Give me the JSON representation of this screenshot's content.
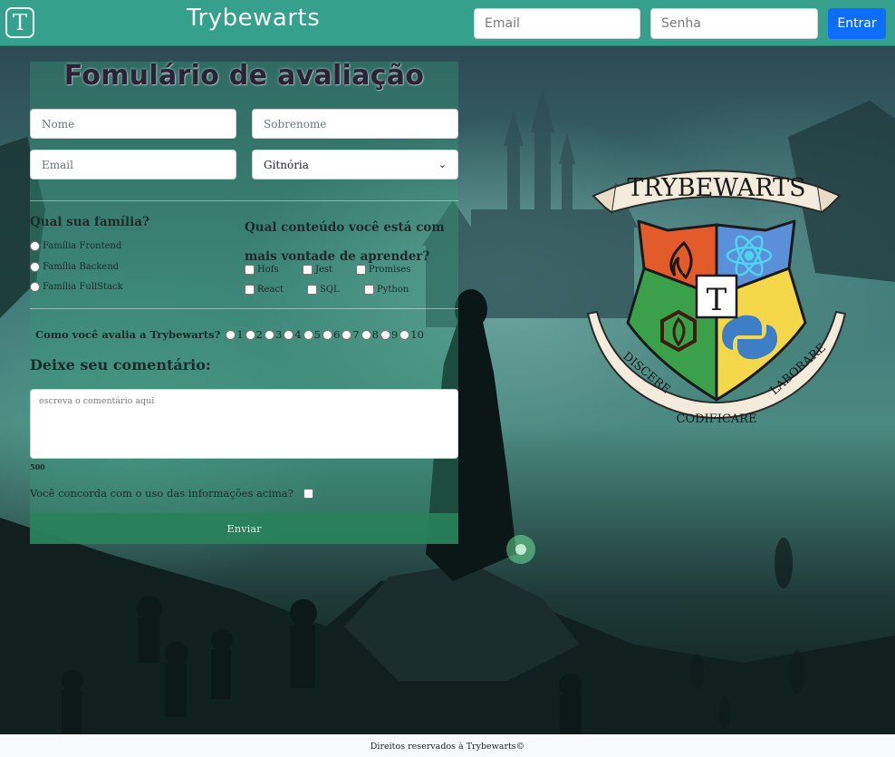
{
  "header": {
    "logo_letter": "T",
    "brand": "Trybewarts",
    "email_placeholder": "Email",
    "password_placeholder": "Senha",
    "login_button": "Entrar"
  },
  "form": {
    "title": "Fomulário de avaliação",
    "name_placeholder": "Nome",
    "lastname_placeholder": "Sobrenome",
    "email_placeholder": "Email",
    "house_selected": "Gitnória",
    "family_question": "Qual sua família?",
    "families": [
      "Família Frontend",
      "Família Backend",
      "Família FullStack"
    ],
    "content_question": "Qual conteúdo você está com mais vontade de aprender?",
    "subjects": [
      "Hofs",
      "Jest",
      "Promises",
      "React",
      "SQL",
      "Python"
    ],
    "rate_question": "Como você avalia a Trybewarts?",
    "rate_options": [
      "1",
      "2",
      "3",
      "4",
      "5",
      "6",
      "7",
      "8",
      "9",
      "10"
    ],
    "comment_label": "Deixe seu comentário:",
    "comment_placeholder": "escreva o comentário aqui",
    "counter": "500",
    "agreement": "Você concorda com o uso das informações acima?",
    "submit": "Enviar"
  },
  "crest": {
    "banner_top": "TRYBEWARTS",
    "letter": "T",
    "motto_left": "DISCERE",
    "motto_bottom": "CODIFICARE",
    "motto_right": "LABORARE",
    "colors": {
      "orange": "#e35a2b",
      "blue": "#5b8fd8",
      "green": "#3aa04a",
      "yellow": "#f5d84a",
      "scroll": "#f3ecdc"
    }
  },
  "footer": {
    "text": "Direitos reservados à Trybewarts©"
  },
  "theme": {
    "header_bg": "#35a08b",
    "primary_button": "#0d6efd"
  }
}
